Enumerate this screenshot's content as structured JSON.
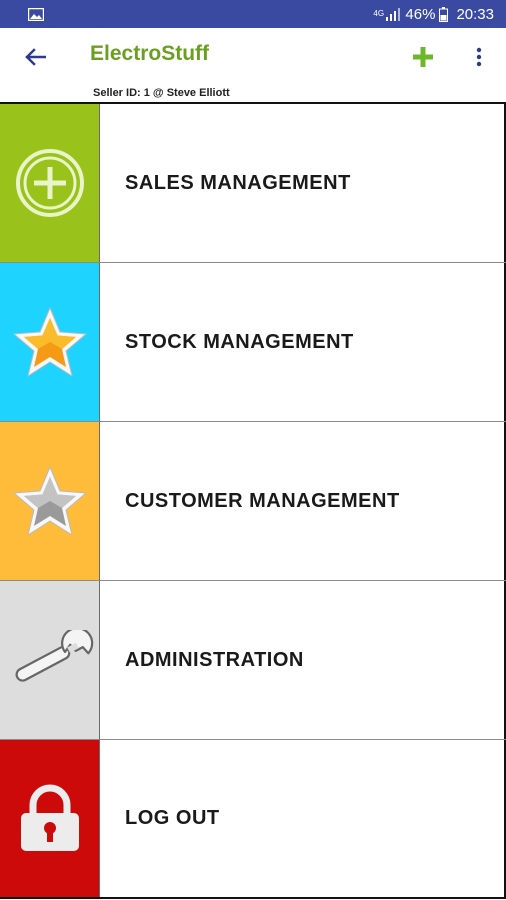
{
  "status_bar": {
    "network_type": "4G",
    "battery_percent": "46%",
    "time": "20:33",
    "icons": [
      "gallery-notification-icon",
      "signal-icon",
      "battery-icon"
    ]
  },
  "app_bar": {
    "title": "ElectroStuff",
    "subtitle": "Seller ID: 1 @ Steve Elliott",
    "icons": [
      "back-arrow-icon",
      "add-icon",
      "more-vert-icon"
    ]
  },
  "colors": {
    "status_bar": "#3a4aa0",
    "title": "#6a9f1f",
    "sales_tile": "#99c21b",
    "stock_tile": "#1ed4ff",
    "customer_tile": "#ffbb3a",
    "admin_tile": "#dddddd",
    "logout_tile": "#cc0a0a"
  },
  "menu": {
    "items": [
      {
        "label": "SALES MANAGEMENT",
        "icon": "circle-plus-icon"
      },
      {
        "label": "STOCK MANAGEMENT",
        "icon": "gold-star-icon"
      },
      {
        "label": "CUSTOMER MANAGEMENT",
        "icon": "silver-star-icon"
      },
      {
        "label": "ADMINISTRATION",
        "icon": "wrench-icon"
      },
      {
        "label": "LOG OUT",
        "icon": "padlock-icon"
      }
    ]
  }
}
